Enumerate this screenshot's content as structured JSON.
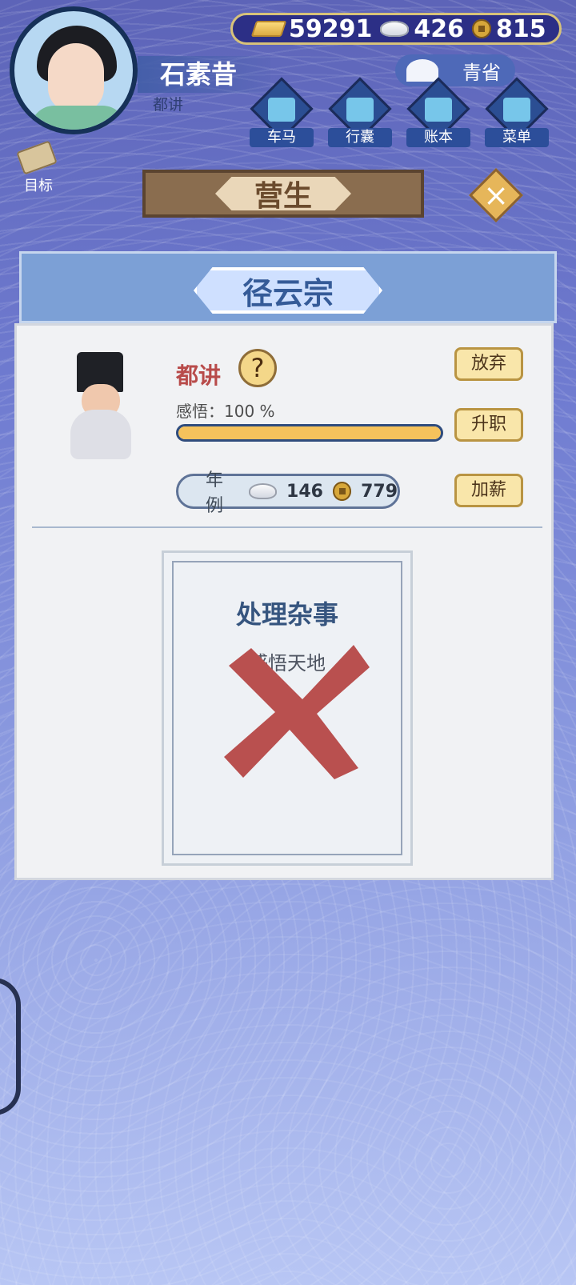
{
  "resources": {
    "gold": "59291",
    "silver": "426",
    "coin": "815"
  },
  "player": {
    "name": "石素昔",
    "rank": "都讲"
  },
  "qingxing": {
    "label": "青省"
  },
  "menu": [
    {
      "label": "车马",
      "icon": "horse-cart-icon"
    },
    {
      "label": "行囊",
      "icon": "bag-icon"
    },
    {
      "label": "账本",
      "icon": "ledger-icon"
    },
    {
      "label": "菜单",
      "icon": "more-icon"
    }
  ],
  "target": {
    "label": "目标"
  },
  "section": {
    "title": "营生"
  },
  "panel": {
    "title": "径云宗",
    "position_title": "都讲",
    "help_symbol": "?",
    "enlightenment": "感悟：100 %",
    "enlightenment_progress": 1.0,
    "salary_label": "年例",
    "salary_silver": "146",
    "salary_coin": "779",
    "buttons": {
      "abandon": "放弃",
      "promote": "升职",
      "raise": "加薪"
    }
  },
  "task": {
    "title": "处理杂事",
    "description": "感悟天地"
  },
  "colors": {
    "background_top": "#5d64b8",
    "accent_gold": "#d7c27a",
    "title_blue": "#355b98",
    "cross_red": "#b9504f"
  }
}
